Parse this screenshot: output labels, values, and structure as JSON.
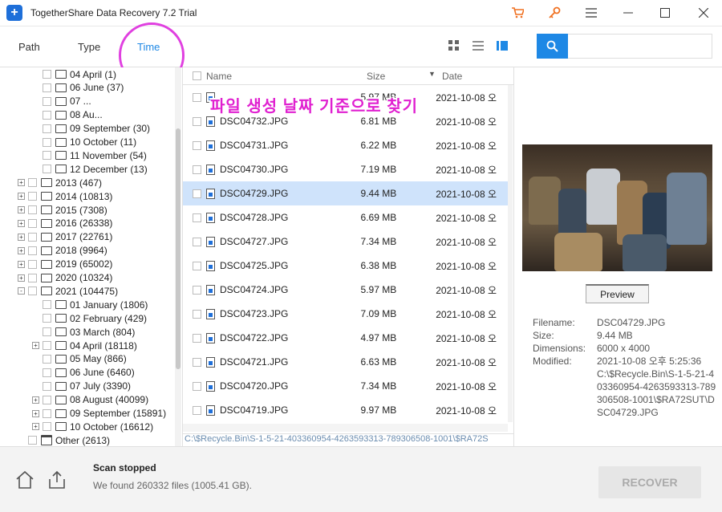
{
  "window": {
    "title": "TogetherShare Data Recovery 7.2 Trial"
  },
  "tabs": [
    {
      "label": "Path"
    },
    {
      "label": "Type"
    },
    {
      "label": "Time"
    }
  ],
  "annotation": "파일 생성 날짜 기준으로 찾기",
  "tree": [
    {
      "label": "04 April (1)",
      "level": 2,
      "expander": "",
      "icon": "folder"
    },
    {
      "label": "06 June (37)",
      "level": 2,
      "expander": "",
      "icon": "folder"
    },
    {
      "label": "07 ...",
      "level": 2,
      "expander": "",
      "icon": "folder"
    },
    {
      "label": "08 Au...",
      "level": 2,
      "expander": "",
      "icon": "folder"
    },
    {
      "label": "09 September (30)",
      "level": 2,
      "expander": "",
      "icon": "folder"
    },
    {
      "label": "10 October (11)",
      "level": 2,
      "expander": "",
      "icon": "folder"
    },
    {
      "label": "11 November (54)",
      "level": 2,
      "expander": "",
      "icon": "folder"
    },
    {
      "label": "12 December (13)",
      "level": 2,
      "expander": "",
      "icon": "folder"
    },
    {
      "label": "2013 (467)",
      "level": 1,
      "expander": "+",
      "icon": "folder"
    },
    {
      "label": "2014 (10813)",
      "level": 1,
      "expander": "+",
      "icon": "folder"
    },
    {
      "label": "2015 (7308)",
      "level": 1,
      "expander": "+",
      "icon": "folder"
    },
    {
      "label": "2016 (26338)",
      "level": 1,
      "expander": "+",
      "icon": "folder"
    },
    {
      "label": "2017 (22761)",
      "level": 1,
      "expander": "+",
      "icon": "folder"
    },
    {
      "label": "2018 (9964)",
      "level": 1,
      "expander": "+",
      "icon": "folder"
    },
    {
      "label": "2019 (65002)",
      "level": 1,
      "expander": "+",
      "icon": "folder"
    },
    {
      "label": "2020 (10324)",
      "level": 1,
      "expander": "+",
      "icon": "folder"
    },
    {
      "label": "2021 (104475)",
      "level": 1,
      "expander": "-",
      "icon": "folder"
    },
    {
      "label": "01 January (1806)",
      "level": 2,
      "expander": "",
      "icon": "folder"
    },
    {
      "label": "02 February (429)",
      "level": 2,
      "expander": "",
      "icon": "folder"
    },
    {
      "label": "03 March (804)",
      "level": 2,
      "expander": "",
      "icon": "folder"
    },
    {
      "label": "04 April (18118)",
      "level": 2,
      "expander": "+",
      "icon": "folder"
    },
    {
      "label": "05 May (866)",
      "level": 2,
      "expander": "",
      "icon": "folder"
    },
    {
      "label": "06 June (6460)",
      "level": 2,
      "expander": "",
      "icon": "folder"
    },
    {
      "label": "07 July (3390)",
      "level": 2,
      "expander": "",
      "icon": "folder"
    },
    {
      "label": "08 August (40099)",
      "level": 2,
      "expander": "+",
      "icon": "folder"
    },
    {
      "label": "09 September (15891)",
      "level": 2,
      "expander": "+",
      "icon": "folder"
    },
    {
      "label": "10 October (16612)",
      "level": 2,
      "expander": "+",
      "icon": "folder"
    },
    {
      "label": "Other (2613)",
      "level": 1,
      "expander": "",
      "icon": "calendar"
    }
  ],
  "list": {
    "headers": {
      "name": "Name",
      "size": "Size",
      "date": "Date"
    },
    "rows": [
      {
        "name": "",
        "size": "5.97 MB",
        "date": "2021-10-08 오",
        "selected": false
      },
      {
        "name": "DSC04732.JPG",
        "size": "6.81 MB",
        "date": "2021-10-08 오",
        "selected": false
      },
      {
        "name": "DSC04731.JPG",
        "size": "6.22 MB",
        "date": "2021-10-08 오",
        "selected": false
      },
      {
        "name": "DSC04730.JPG",
        "size": "7.19 MB",
        "date": "2021-10-08 오",
        "selected": false
      },
      {
        "name": "DSC04729.JPG",
        "size": "9.44 MB",
        "date": "2021-10-08 오",
        "selected": true
      },
      {
        "name": "DSC04728.JPG",
        "size": "6.69 MB",
        "date": "2021-10-08 오",
        "selected": false
      },
      {
        "name": "DSC04727.JPG",
        "size": "7.34 MB",
        "date": "2021-10-08 오",
        "selected": false
      },
      {
        "name": "DSC04725.JPG",
        "size": "6.38 MB",
        "date": "2021-10-08 오",
        "selected": false
      },
      {
        "name": "DSC04724.JPG",
        "size": "5.97 MB",
        "date": "2021-10-08 오",
        "selected": false
      },
      {
        "name": "DSC04723.JPG",
        "size": "7.09 MB",
        "date": "2021-10-08 오",
        "selected": false
      },
      {
        "name": "DSC04722.JPG",
        "size": "4.97 MB",
        "date": "2021-10-08 오",
        "selected": false
      },
      {
        "name": "DSC04721.JPG",
        "size": "6.63 MB",
        "date": "2021-10-08 오",
        "selected": false
      },
      {
        "name": "DSC04720.JPG",
        "size": "7.34 MB",
        "date": "2021-10-08 오",
        "selected": false
      },
      {
        "name": "DSC04719.JPG",
        "size": "9.97 MB",
        "date": "2021-10-08 오",
        "selected": false
      }
    ],
    "path": "C:\\$Recycle.Bin\\S-1-5-21-403360954-4263593313-789306508-1001\\$RA72S"
  },
  "preview": {
    "button": "Preview",
    "labels": {
      "filename": "Filename:",
      "size": "Size:",
      "dimensions": "Dimensions:",
      "modified": "Modified:"
    },
    "values": {
      "filename": "DSC04729.JPG",
      "size": "9.44 MB",
      "dimensions": "6000 x 4000",
      "modified": "2021-10-08 오후 5:25:36",
      "path": "C:\\$Recycle.Bin\\S-1-5-21-403360954-4263593313-789306508-1001\\$RA72SUT\\DSC04729.JPG"
    }
  },
  "status": {
    "title": "Scan stopped",
    "detail": "We found 260332 files (1005.41 GB)."
  },
  "recover_label": "RECOVER",
  "colors": {
    "accent": "#1e88e5",
    "annotation": "#e020d0",
    "selected_row": "#cfe3fb"
  }
}
